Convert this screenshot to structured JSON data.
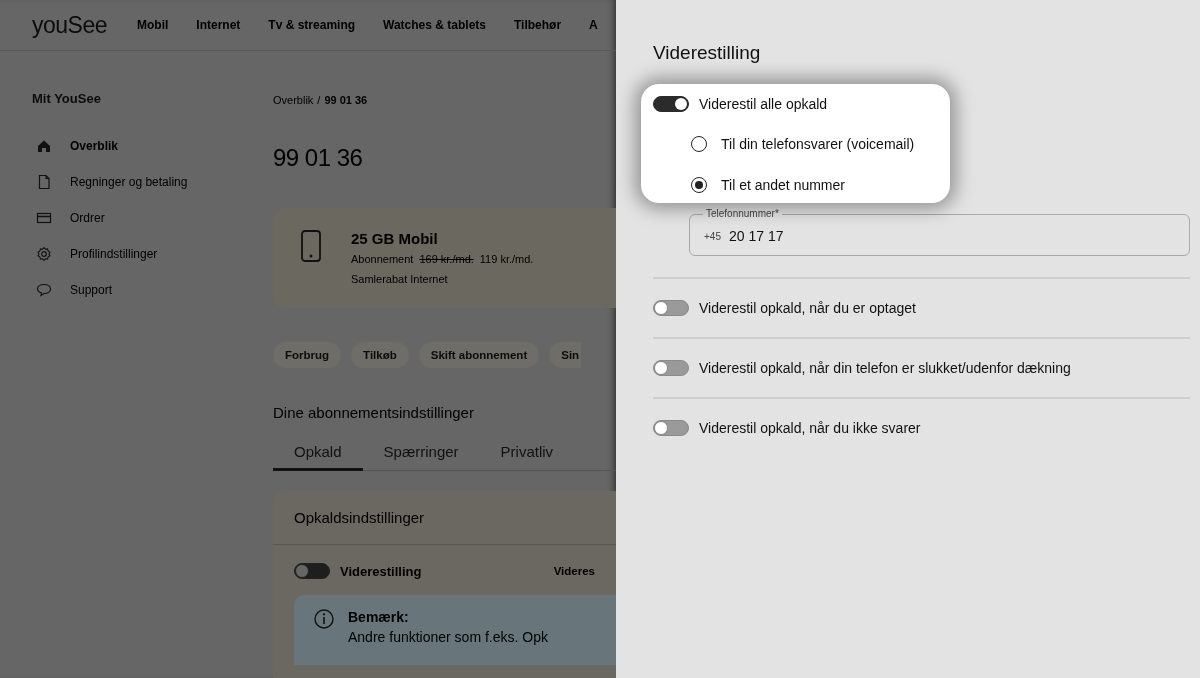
{
  "header": {
    "logo": "youSee",
    "nav": [
      "Mobil",
      "Internet",
      "Tv & streaming",
      "Watches & tablets",
      "Tilbehør",
      "A"
    ]
  },
  "sidebar": {
    "title": "Mit YouSee",
    "items": [
      {
        "label": "Overblik",
        "selected": true
      },
      {
        "label": "Regninger og betaling",
        "selected": false
      },
      {
        "label": "Ordrer",
        "selected": false
      },
      {
        "label": "Profilindstillinger",
        "selected": false
      },
      {
        "label": "Support",
        "selected": false
      }
    ]
  },
  "main": {
    "breadcrumb": {
      "parent": "Overblik",
      "separator": "/",
      "current": "99 01 36"
    },
    "heading": "99 01 36",
    "plan": {
      "title": "25 GB Mobil",
      "subscription_label": "Abonnement",
      "old_price": "169 kr./md.",
      "price": "119 kr./md.",
      "discount": "Samlerabat Internet"
    },
    "chips": [
      "Forbrug",
      "Tilkøb",
      "Skift abonnement",
      "Sin"
    ],
    "settings_title": "Dine abonnementsindstillinger",
    "tabs": [
      {
        "label": "Opkald",
        "selected": true
      },
      {
        "label": "Spærringer",
        "selected": false
      },
      {
        "label": "Privatliv",
        "selected": false
      }
    ],
    "card": {
      "title": "Opkaldsindstillinger",
      "toggle": {
        "label": "Viderestilling",
        "on": false
      },
      "side_text": "Videres",
      "notice": {
        "title": "Bemærk:",
        "text": "Andre funktioner som f.eks. Opk"
      }
    }
  },
  "drawer": {
    "title": "Viderestilling",
    "all_calls": {
      "label": "Viderestil alle opkald",
      "on": true,
      "options": [
        {
          "label": "Til din telefonsvarer (voicemail)",
          "selected": false
        },
        {
          "label": "Til et andet nummer",
          "selected": true
        }
      ],
      "phone_field": {
        "label": "Telefonnummer*",
        "prefix": "+45",
        "value": "20 17 17"
      }
    },
    "rules": [
      {
        "label": "Viderestil opkald, når du er optaget",
        "on": false
      },
      {
        "label": "Viderestil opkald, når din telefon er slukket/udenfor dækning",
        "on": false
      },
      {
        "label": "Viderestil opkald, når du ikke svarer",
        "on": false
      }
    ]
  }
}
